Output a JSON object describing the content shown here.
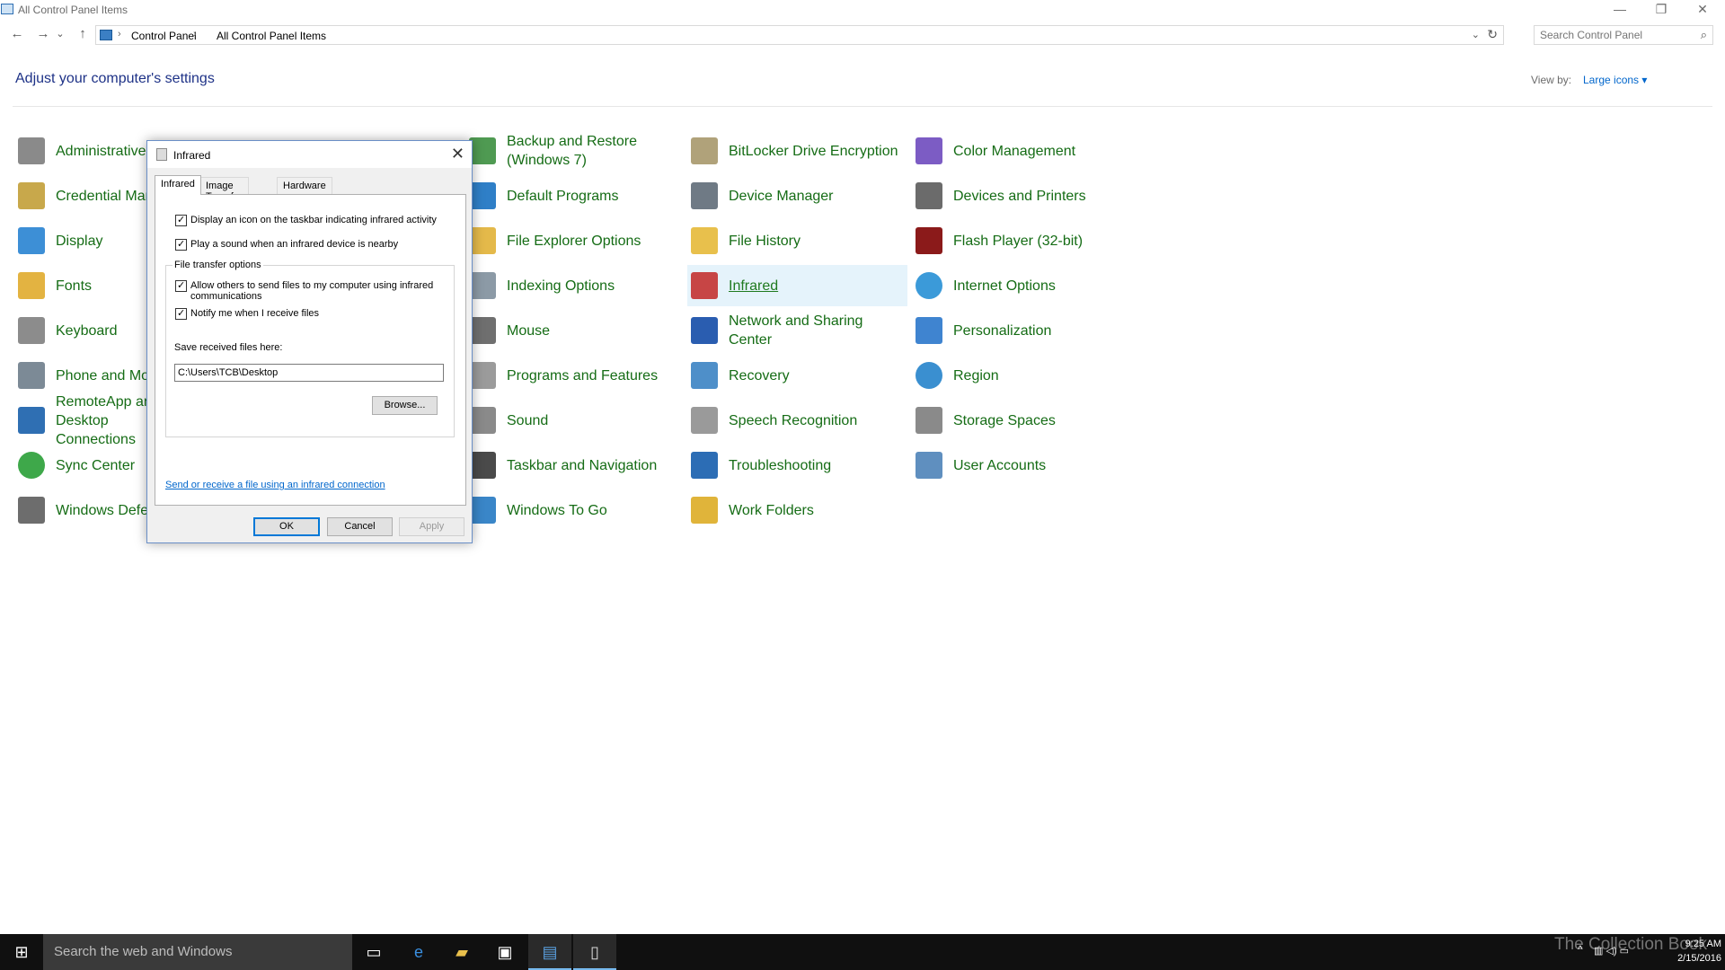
{
  "window": {
    "title": "All Control Panel Items"
  },
  "window_controls": {
    "minimize": "—",
    "restore": "❐",
    "close": "✕"
  },
  "nav": {
    "back": "←",
    "forward": "→",
    "recent": "⌄",
    "up": "↑"
  },
  "address": {
    "crumbs": [
      "Control Panel",
      "All Control Panel Items"
    ],
    "separator": "›",
    "dropdown": "⌄",
    "refresh": "↻"
  },
  "search": {
    "placeholder": "Search Control Panel"
  },
  "header": {
    "title": "Adjust your computer's settings",
    "view_by_label": "View by:",
    "view_by_value": "Large icons ▾"
  },
  "items": {
    "col1": [
      {
        "label": "Administrative Tools",
        "icon": "admin-tools-icon",
        "color": "#8a8a8a"
      },
      {
        "label": "Credential Manager",
        "icon": "credential-icon",
        "color": "#c8a84b"
      },
      {
        "label": "Display",
        "icon": "display-icon",
        "color": "#3d8fd6"
      },
      {
        "label": "Fonts",
        "icon": "fonts-icon",
        "color": "#e3b341"
      },
      {
        "label": "Keyboard",
        "icon": "keyboard-icon",
        "color": "#8c8c8c"
      },
      {
        "label": "Phone and Modem",
        "icon": "phone-icon",
        "color": "#7c8a96"
      },
      {
        "label": "RemoteApp and Desktop Connections",
        "icon": "remoteapp-icon",
        "color": "#2f6fb3"
      },
      {
        "label": "Sync Center",
        "icon": "sync-icon",
        "color": "#3ea84a"
      },
      {
        "label": "Windows Defender",
        "icon": "defender-icon",
        "color": "#6d6d6d"
      }
    ],
    "col2": [
      {
        "label": "Backup and Restore (Windows 7)",
        "icon": "backup-icon",
        "color": "#4f9a52"
      },
      {
        "label": "Default Programs",
        "icon": "default-programs-icon",
        "color": "#2f7fc7"
      },
      {
        "label": "File Explorer Options",
        "icon": "folder-options-icon",
        "color": "#e4b94a"
      },
      {
        "label": "Indexing Options",
        "icon": "indexing-icon",
        "color": "#8c9aa6"
      },
      {
        "label": "Mouse",
        "icon": "mouse-icon",
        "color": "#6f6f6f"
      },
      {
        "label": "Programs and Features",
        "icon": "programs-icon",
        "color": "#9b9b9b"
      },
      {
        "label": "Sound",
        "icon": "sound-icon",
        "color": "#8a8a8a"
      },
      {
        "label": "Taskbar and Navigation",
        "icon": "taskbar-icon",
        "color": "#4a4a4a"
      },
      {
        "label": "Windows To Go",
        "icon": "windows-to-go-icon",
        "color": "#3a86c8"
      }
    ],
    "col3": [
      {
        "label": "BitLocker Drive Encryption",
        "icon": "bitlocker-icon",
        "color": "#b0a27a"
      },
      {
        "label": "Device Manager",
        "icon": "device-manager-icon",
        "color": "#6f7a85"
      },
      {
        "label": "File History",
        "icon": "file-history-icon",
        "color": "#e8c04c"
      },
      {
        "label": "Infrared",
        "icon": "infrared-icon",
        "color": "#c74545"
      },
      {
        "label": "Network and Sharing Center",
        "icon": "network-icon",
        "color": "#2a5db0"
      },
      {
        "label": "Recovery",
        "icon": "recovery-icon",
        "color": "#4e8fc9"
      },
      {
        "label": "Speech Recognition",
        "icon": "microphone-icon",
        "color": "#9a9a9a"
      },
      {
        "label": "Troubleshooting",
        "icon": "troubleshooting-icon",
        "color": "#2c6db5"
      },
      {
        "label": "Work Folders",
        "icon": "work-folders-icon",
        "color": "#e0b43a"
      }
    ],
    "col4": [
      {
        "label": "Color Management",
        "icon": "color-management-icon",
        "color": "#7c5cc4"
      },
      {
        "label": "Devices and Printers",
        "icon": "printer-icon",
        "color": "#6b6b6b"
      },
      {
        "label": "Flash Player (32-bit)",
        "icon": "flash-icon",
        "color": "#8b1a1a"
      },
      {
        "label": "Internet Options",
        "icon": "internet-options-icon",
        "color": "#3b9ad9"
      },
      {
        "label": "Personalization",
        "icon": "personalization-icon",
        "color": "#3f84d0"
      },
      {
        "label": "Region",
        "icon": "region-icon",
        "color": "#3a8fd0"
      },
      {
        "label": "Storage Spaces",
        "icon": "storage-icon",
        "color": "#8a8a8a"
      },
      {
        "label": "User Accounts",
        "icon": "user-accounts-icon",
        "color": "#5f8fbf"
      }
    ]
  },
  "dialog": {
    "title": "Infrared",
    "close": "✕",
    "tabs": [
      "Infrared",
      "Image Transfer",
      "Hardware"
    ],
    "opt_taskbar_icon": "Display an icon on the taskbar indicating infrared activity",
    "opt_play_sound": "Play a sound when an infrared device is nearby",
    "group_title": "File transfer options",
    "opt_allow_send": "Allow others to send files to my computer using infrared communications",
    "opt_notify": "Notify me when I receive files",
    "save_label": "Save received files here:",
    "save_path": "C:\\Users\\TCB\\Desktop",
    "browse": "Browse...",
    "link": "Send or receive a file using an infrared connection",
    "ok": "OK",
    "cancel": "Cancel",
    "apply": "Apply"
  },
  "taskbar": {
    "start": "⊞",
    "search_text": "Search the web and Windows",
    "tray_chevron": "^",
    "tray_icons": "▥ ◁) ▭",
    "time": "9:25 AM",
    "date": "2/15/2016"
  },
  "watermark": "The Collection Book"
}
